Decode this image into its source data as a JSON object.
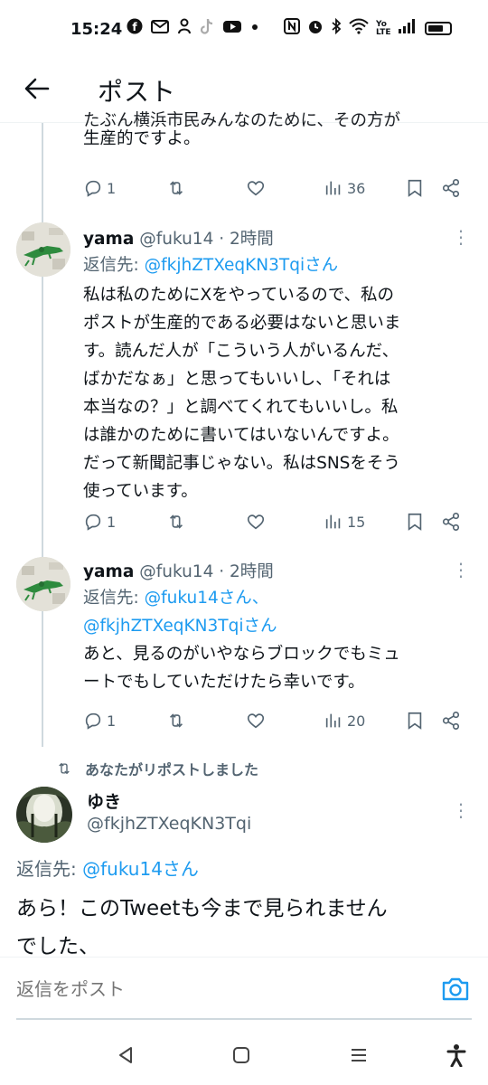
{
  "status_bar": {
    "time": "15:24",
    "left_icons": [
      "facebook-icon",
      "mail-icon",
      "person-icon",
      "tiktok-icon",
      "youtube-icon",
      "dot-icon"
    ],
    "right_icons": [
      "nfc-icon",
      "alarm-icon",
      "bluetooth-icon",
      "wifi-icon",
      "volte-icon",
      "signal-icon",
      "battery-icon"
    ],
    "volte_text": "Yo LTE"
  },
  "header": {
    "title": "ポスト"
  },
  "partial_tweet": {
    "line1": "たぶん横浜市民みんなのために、その方が",
    "line2": "生産的ですよ。",
    "replies": "1",
    "views": "36"
  },
  "tweets": [
    {
      "name": "yama",
      "handle_time": "@fuku14 · 2時間",
      "replyto_label": "返信先: ",
      "replyto_mentions": [
        "@fkjhZTXeqKN3Tqiさん"
      ],
      "body_lines": [
        "私は私のためにXをやっているので、私の",
        "ポストが生産的である必要はないと思いま",
        "す。読んだ人が「こういう人がいるんだ、",
        "ばかだなぁ」と思ってもいいし、「それは",
        "本当なの？」と調べてくれてもいいし。私",
        "は誰かのために書いてはいないんですよ。",
        "だって新聞記事じゃない。私はSNSをそう",
        "使っています。"
      ],
      "replies": "1",
      "views": "15"
    },
    {
      "name": "yama",
      "handle_time": "@fuku14 · 2時間",
      "replyto_label": "返信先: ",
      "replyto_mentions": [
        "@fuku14さん、",
        "@fkjhZTXeqKN3Tqiさん"
      ],
      "body_lines": [
        "あと、見るのがいやならブロックでもミュ",
        "ートでもしていただけたら幸いです。"
      ],
      "replies": "1",
      "views": "20"
    }
  ],
  "repost_notice": "あなたがリポストしました",
  "main_tweet": {
    "name": "ゆき",
    "handle": "@fkjhZTXeqKN3Tqi",
    "replyto_label": "返信先: ",
    "replyto_mention": "@fuku14さん",
    "body_line1": "あら！このTweetも今まで見られません",
    "body_line2": "でした、"
  },
  "composer": {
    "placeholder": "返信をポスト"
  },
  "navbar": {
    "buttons": [
      "back-nav-icon",
      "home-nav-icon",
      "recents-nav-icon",
      "accessibility-icon"
    ]
  }
}
